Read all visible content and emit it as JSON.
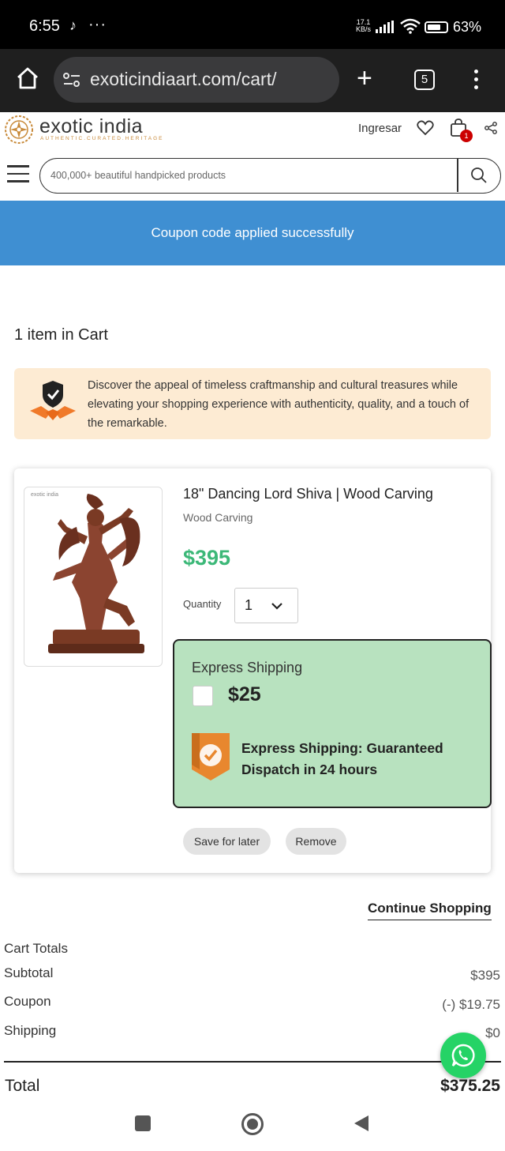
{
  "status_bar": {
    "time": "6:55",
    "network_speed_value": "17.1",
    "network_speed_unit": "KB/s",
    "battery_percent": "63%"
  },
  "browser": {
    "url": "exoticindiaart.com/cart/",
    "tab_count": "5"
  },
  "site": {
    "logo_name": "exotic india",
    "logo_tagline": "AUTHENTIC.CURATED.HERITAGE",
    "login_label": "Ingresar",
    "cart_badge_count": "1",
    "search_placeholder": "400,000+ beautiful handpicked products"
  },
  "banner": {
    "message": "Coupon code applied successfully",
    "color": "#3f8fd2"
  },
  "cart": {
    "item_count_label": "1 item in Cart",
    "info_text": "Discover the appeal of timeless craftmanship and cultural treasures while elevating your shopping experience with authenticity, quality, and a touch of the remarkable.",
    "item": {
      "image_watermark": "exotic india",
      "title": "18\" Dancing Lord Shiva | Wood Carving",
      "category": "Wood Carving",
      "price": "$395",
      "price_color": "#3cb878",
      "quantity_label": "Quantity",
      "quantity_value": "1",
      "express": {
        "title": "Express Shipping",
        "price": "$25",
        "checked": false,
        "guarantee_text": "Express Shipping: Guaranteed Dispatch in 24 hours",
        "background": "#b8e2bf"
      },
      "save_for_later_label": "Save for later",
      "remove_label": "Remove"
    },
    "continue_shopping_label": "Continue Shopping"
  },
  "totals": {
    "title": "Cart Totals",
    "rows": [
      {
        "label": "Subtotal",
        "value": "$395"
      },
      {
        "label": "Coupon",
        "value": "(-) $19.75"
      },
      {
        "label": "Shipping",
        "value": "$0"
      }
    ],
    "total_label": "Total",
    "total_value": "$375.25"
  },
  "icons": {
    "whatsapp_color": "#25d366"
  }
}
